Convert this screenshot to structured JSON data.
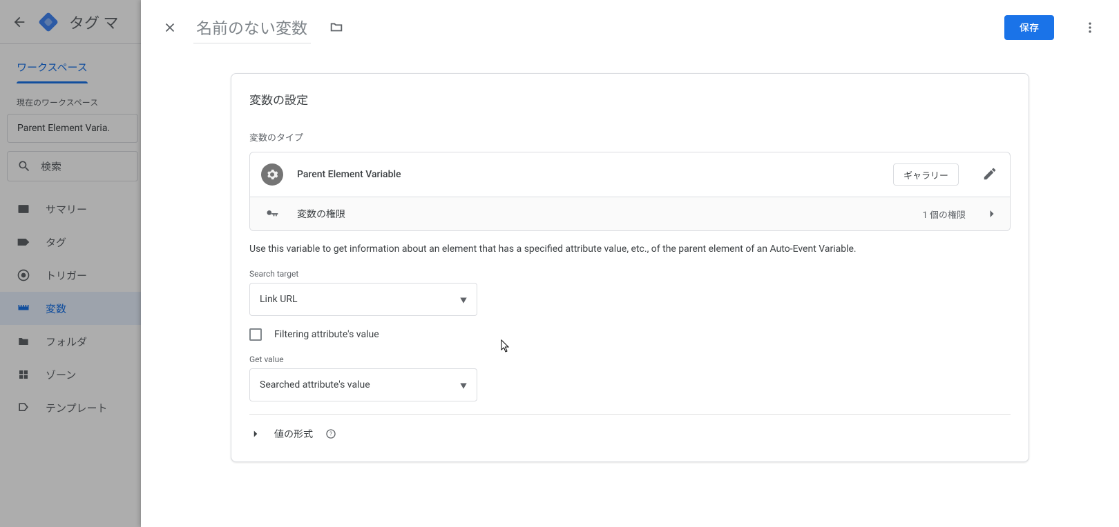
{
  "bg_header": {
    "title": "タグ マ"
  },
  "tabs": {
    "workspace": "ワークスペース"
  },
  "sidebar": {
    "ws_label": "現在のワークスペース",
    "ws_name": "Parent Element Varia.",
    "search_placeholder": "検索",
    "items": [
      {
        "label": "サマリー"
      },
      {
        "label": "タグ"
      },
      {
        "label": "トリガー"
      },
      {
        "label": "変数"
      },
      {
        "label": "フォルダ"
      },
      {
        "label": "ゾーン"
      },
      {
        "label": "テンプレート"
      }
    ]
  },
  "panel": {
    "name": "名前のない変数",
    "save": "保存",
    "card_title": "変数の設定",
    "type_label": "変数のタイプ",
    "type_name": "Parent Element Variable",
    "gallery": "ギャラリー",
    "perm_label": "変数の権限",
    "perm_count": "1 個の権限",
    "description": "Use this variable to get information about an element that has a specified attribute value, etc., of the parent element of an Auto-Event Variable.",
    "search_target_label": "Search target",
    "search_target_value": "Link URL",
    "filter_label": "Filtering attribute's value",
    "get_value_label": "Get value",
    "get_value_value": "Searched attribute's value",
    "format_label": "値の形式"
  }
}
